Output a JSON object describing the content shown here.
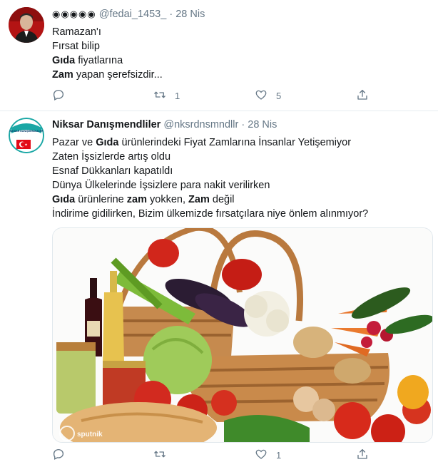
{
  "tweets": [
    {
      "display_name": "◉◉◉◉◉",
      "handle": "@fedai_1453_",
      "separator": "·",
      "date": "28 Nis",
      "lines": [
        [
          {
            "text": "Ramazan'ı",
            "bold": false
          }
        ],
        [
          {
            "text": "Fırsat bilip",
            "bold": false
          }
        ],
        [
          {
            "text": "Gıda",
            "bold": true
          },
          {
            "text": " fiyatlarına",
            "bold": false
          }
        ],
        [
          {
            "text": "Zam",
            "bold": true
          },
          {
            "text": " yapan şerefsizdir...",
            "bold": false
          }
        ]
      ],
      "actions": {
        "reply": "",
        "retweet": "1",
        "like": "5"
      },
      "icons": [
        "reply-icon",
        "retweet-icon",
        "like-icon",
        "share-icon"
      ]
    },
    {
      "display_name": "Niksar Danışmendliler",
      "handle": "@nksrdnsmndllr",
      "separator": "·",
      "date": "28 Nis",
      "lines": [
        [
          {
            "text": "Pazar  ve ",
            "bold": false
          },
          {
            "text": "Gıda",
            "bold": true
          },
          {
            "text": " ürünlerindeki Fiyat Zamlarına İnsanlar Yetişemiyor",
            "bold": false
          }
        ],
        [
          {
            "text": "Zaten İşsizlerde artış oldu",
            "bold": false
          }
        ],
        [
          {
            "text": "Esnaf Dükkanları kapatıldı",
            "bold": false
          }
        ],
        [
          {
            "text": "Dünya Ülkelerinde İşsizlere para nakit verilirken",
            "bold": false
          }
        ],
        [
          {
            "text": "Gıda",
            "bold": true
          },
          {
            "text": " ürünlerine ",
            "bold": false
          },
          {
            "text": "zam",
            "bold": true
          },
          {
            "text": " yokken, ",
            "bold": false
          },
          {
            "text": "Zam",
            "bold": true
          },
          {
            "text": " değil",
            "bold": false
          }
        ],
        [
          {
            "text": "İndirime gidilirken, Bizim ülkemizde fırsatçılara niye önlem alınmıyor?",
            "bold": false
          }
        ]
      ],
      "actions": {
        "reply": "",
        "retweet": "",
        "like": "1"
      },
      "media": {
        "type": "photo",
        "subject": "vegetable-basket",
        "watermark": "sputnik"
      },
      "avatar_text": "NİKSAR DANIŞMENDLİLER"
    }
  ],
  "colors": {
    "text": "#14171a",
    "muted": "#657786",
    "divider": "#e6ecf0"
  }
}
